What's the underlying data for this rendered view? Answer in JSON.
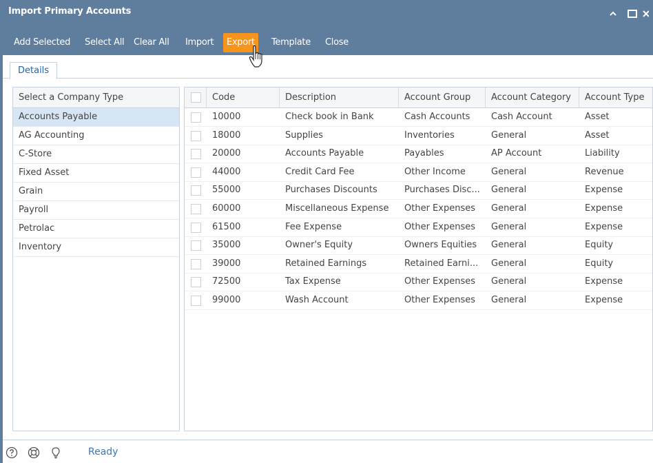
{
  "window": {
    "title": "Import Primary Accounts",
    "controls": [
      "chevron-up-icon",
      "maximize-icon",
      "close-icon"
    ]
  },
  "toolbar": {
    "buttons": [
      "Add Selected",
      "Select All",
      "Clear All",
      "Import",
      "Export",
      "Template",
      "Close"
    ],
    "active": "Export",
    "active_color": "#f7941d"
  },
  "tabs": [
    "Details"
  ],
  "company_types": {
    "header": "Select a Company Type",
    "items": [
      "Accounts Payable",
      "AG Accounting",
      "C-Store",
      "Fixed Asset",
      "Grain",
      "Payroll",
      "Petrolac",
      "Inventory"
    ],
    "selected": "Accounts Payable"
  },
  "grid": {
    "columns": [
      "Code",
      "Description",
      "Account Group",
      "Account Category",
      "Account Type"
    ],
    "rows": [
      [
        "10000",
        "Check book in Bank",
        "Cash Accounts",
        "Cash Account",
        "Asset"
      ],
      [
        "18000",
        "Supplies",
        "Inventories",
        "General",
        "Asset"
      ],
      [
        "20000",
        "Accounts Payable",
        "Payables",
        "AP Account",
        "Liability"
      ],
      [
        "44000",
        "Credit Card Fee",
        "Other Income",
        "General",
        "Revenue"
      ],
      [
        "55000",
        "Purchases Discounts",
        "Purchases Disc...",
        "General",
        "Expense"
      ],
      [
        "60000",
        "Miscellaneous Expense",
        "Other Expenses",
        "General",
        "Expense"
      ],
      [
        "61500",
        "Fee Expense",
        "Other Expenses",
        "General",
        "Expense"
      ],
      [
        "35000",
        "Owner's Equity",
        "Owners Equities",
        "General",
        "Equity"
      ],
      [
        "39000",
        "Retained Earnings",
        "Retained Earni...",
        "General",
        "Equity"
      ],
      [
        "72500",
        "Tax Expense",
        "Other Expenses",
        "General",
        "Expense"
      ],
      [
        "99000",
        "Wash Account",
        "Other Expenses",
        "General",
        "Expense"
      ]
    ]
  },
  "statusbar": {
    "icons": [
      "help-icon",
      "support-icon",
      "lightbulb-icon"
    ],
    "status": "Ready"
  },
  "colors": {
    "titlebar": "#5f7d9c",
    "selected_row": "#d6e6f4",
    "status_text": "#3b77b8"
  }
}
